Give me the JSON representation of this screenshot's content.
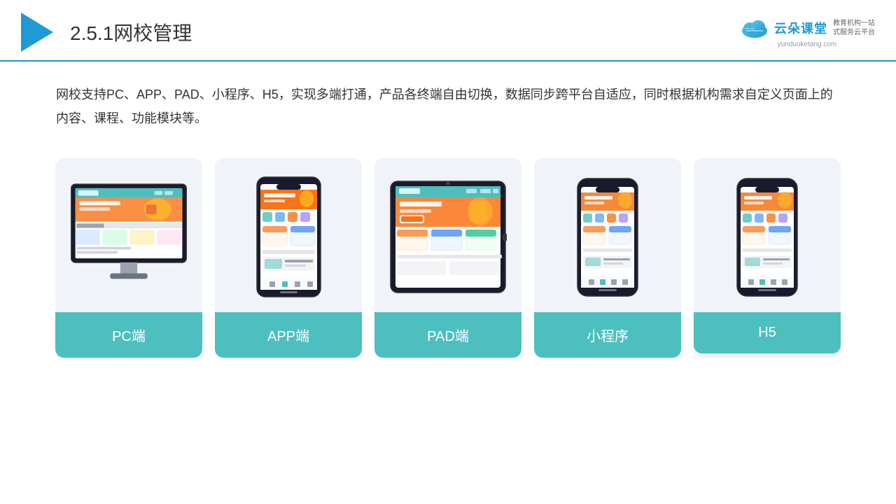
{
  "header": {
    "title_prefix": "2.5.1",
    "title_main": "网校管理",
    "logo_main": "云朵课堂",
    "logo_sub1": "教育机构一站",
    "logo_sub2": "式服务云平台",
    "logo_url": "yunduoketang.com"
  },
  "description": {
    "text": "网校支持PC、APP、PAD、小程序、H5，实现多端打通，产品各终端自由切换，数据同步跨平台自适应，同时根据机构需求自定义页面上的内容、课程、功能模块等。"
  },
  "cards": [
    {
      "id": "pc",
      "label": "PC端",
      "device_type": "pc"
    },
    {
      "id": "app",
      "label": "APP端",
      "device_type": "phone"
    },
    {
      "id": "pad",
      "label": "PAD端",
      "device_type": "tablet"
    },
    {
      "id": "miniprogram",
      "label": "小程序",
      "device_type": "phone_small"
    },
    {
      "id": "h5",
      "label": "H5",
      "device_type": "phone_small"
    }
  ],
  "accent_color": "#4dbfbf",
  "header_line_color": "#2196c4"
}
